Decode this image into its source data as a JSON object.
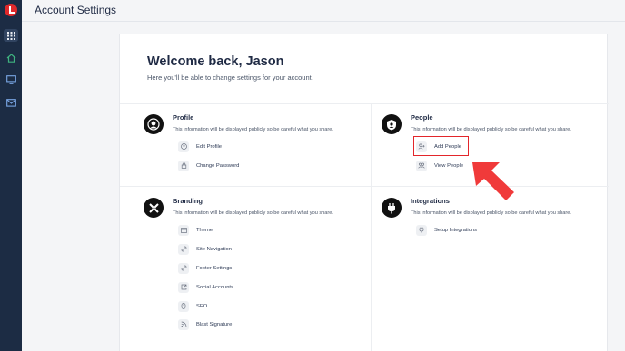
{
  "app": {
    "logo_icon": "brand-logo-icon",
    "accent_color": "#e3262b"
  },
  "sidebar": {
    "items": [
      {
        "icon": "grid-icon",
        "active": true
      },
      {
        "icon": "home-icon",
        "active": false
      },
      {
        "icon": "monitor-icon",
        "active": false
      },
      {
        "icon": "mail-icon",
        "active": false
      }
    ]
  },
  "header": {
    "title": "Account Settings"
  },
  "main": {
    "welcome": "Welcome back, Jason",
    "subtitle": "Here you'll be able to change settings for your account.",
    "sections": {
      "profile": {
        "title": "Profile",
        "description": "This information will be displayed publicly so be careful what you share.",
        "items": [
          "Edit Profile",
          "Change Password"
        ]
      },
      "people": {
        "title": "People",
        "description": "This information will be displayed publicly so be careful what you share.",
        "items": [
          "Add People",
          "View People"
        ]
      },
      "branding": {
        "title": "Branding",
        "description": "This information will be displayed publicly so be careful what you share.",
        "items": [
          "Theme",
          "Site Navigation",
          "Footer Settings",
          "Social Accounts",
          "SEO",
          "Blast Signature"
        ]
      },
      "integrations": {
        "title": "Integrations",
        "description": "This information will be displayed publicly so be careful what you share.",
        "items": [
          "Setup Integrations"
        ]
      }
    }
  }
}
